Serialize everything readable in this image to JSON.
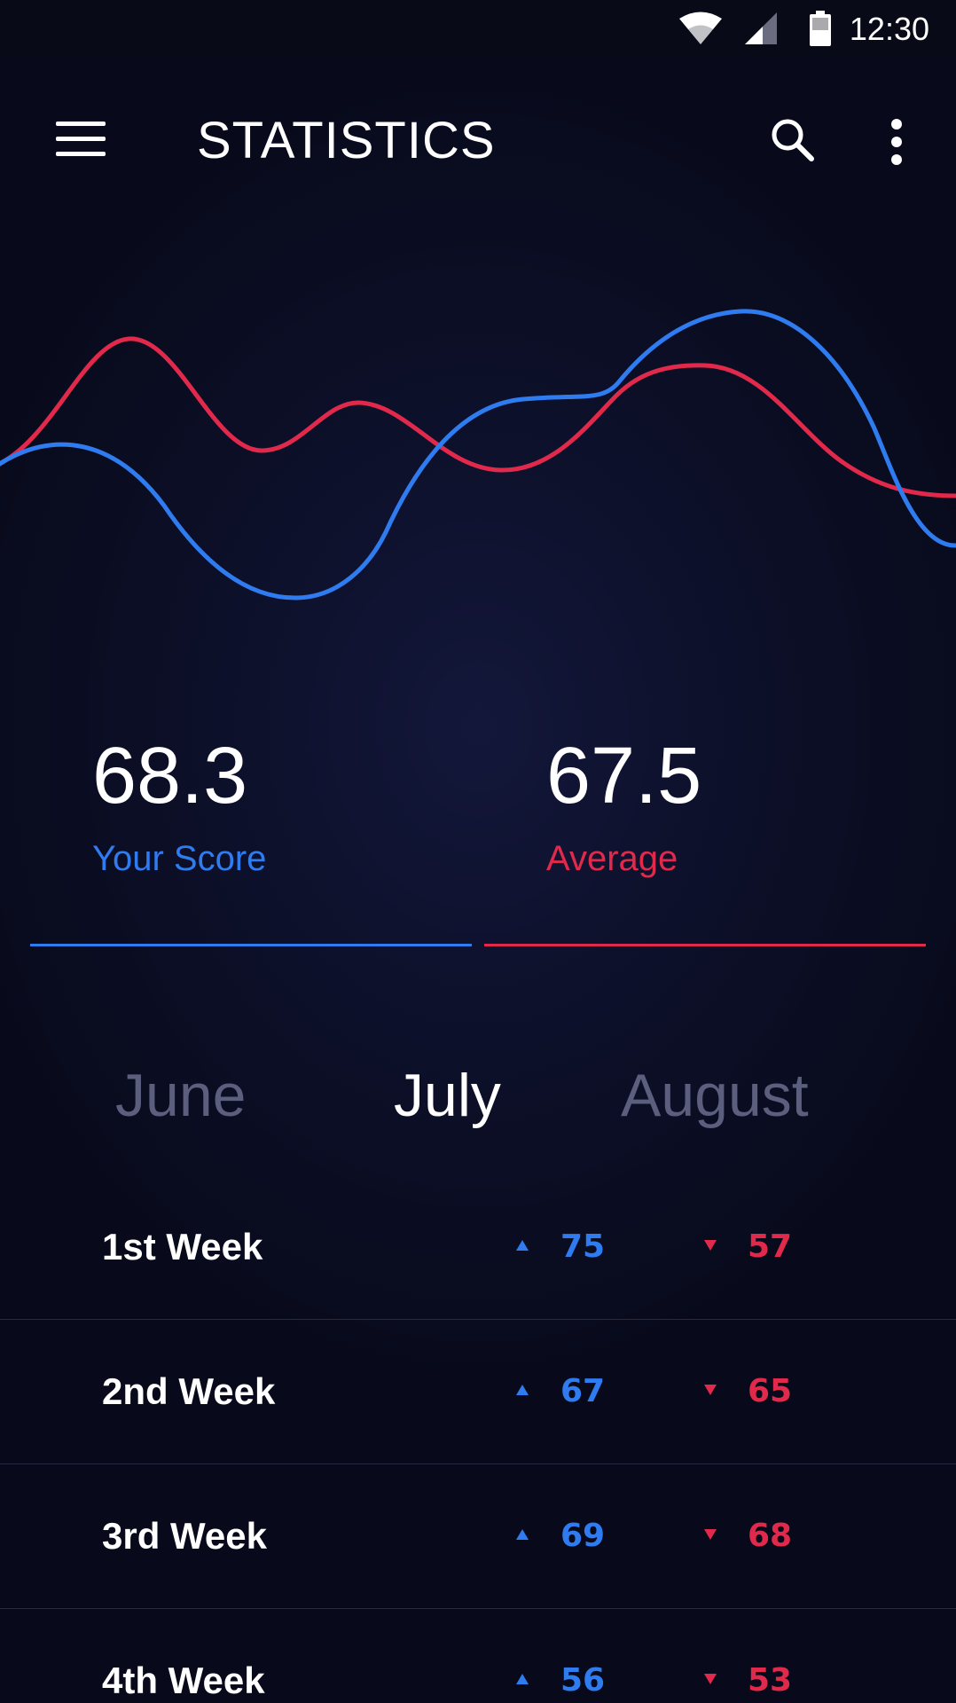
{
  "status_bar": {
    "time": "12:30",
    "icons": [
      "wifi-icon",
      "cell-signal-icon",
      "battery-icon"
    ]
  },
  "app_bar": {
    "title": "STATISTICS",
    "icons": [
      "menu-icon",
      "search-icon",
      "more-vert-icon"
    ]
  },
  "colors": {
    "your_score": "#2f7bf0",
    "average": "#e1294b",
    "month_active": "#ffffff",
    "month_inactive": "#5b5e7c"
  },
  "scores": {
    "yours": {
      "value": "68.3",
      "label": "Your Score"
    },
    "average": {
      "value": "67.5",
      "label": "Average"
    }
  },
  "months": [
    {
      "label": "June",
      "active": false
    },
    {
      "label": "July",
      "active": true
    },
    {
      "label": "August",
      "active": false
    }
  ],
  "weeks": [
    {
      "label": "1st Week",
      "yours": "75",
      "average": "57"
    },
    {
      "label": "2nd Week",
      "yours": "67",
      "average": "65"
    },
    {
      "label": "3rd Week",
      "yours": "69",
      "average": "68"
    },
    {
      "label": "4th Week",
      "yours": "56",
      "average": "53"
    }
  ]
}
